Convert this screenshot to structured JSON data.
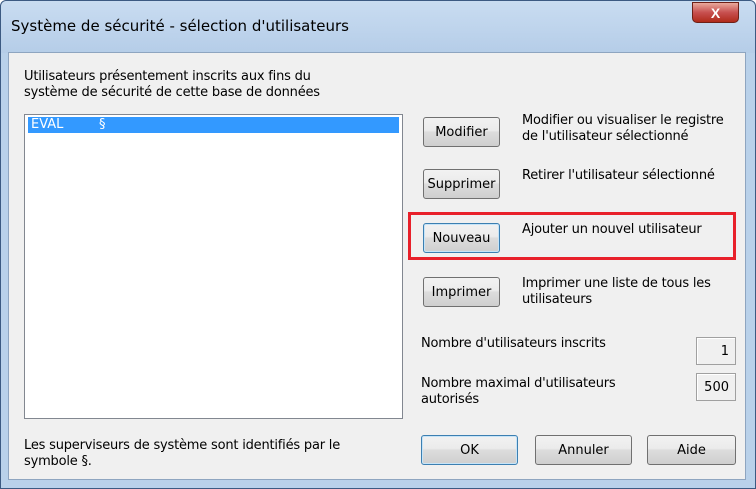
{
  "window": {
    "title": "Système de sécurité - sélection d'utilisateurs",
    "close_glyph": "X"
  },
  "intro_text": [
    "Utilisateurs présentement inscrits aux fins du",
    "système de sécurité de cette base de données"
  ],
  "users": [
    {
      "name": "EVAL",
      "marker": "§",
      "selected": true
    }
  ],
  "actions": {
    "modify": {
      "label": "Modifier",
      "description": [
        "Modifier ou visualiser le registre",
        "de l'utilisateur sélectionné"
      ]
    },
    "delete": {
      "label": "Supprimer",
      "description": [
        "Retirer l'utilisateur sélectionné"
      ]
    },
    "new": {
      "label": "Nouveau",
      "description": [
        "Ajouter un nouvel utilisateur"
      ]
    },
    "print": {
      "label": "Imprimer",
      "description": [
        "Imprimer une liste de tous les",
        "utilisateurs"
      ]
    }
  },
  "stats": {
    "registered_label": "Nombre d'utilisateurs inscrits",
    "registered_value": "1",
    "max_label": [
      "Nombre maximal d'utilisateurs",
      "autorisés"
    ],
    "max_value": "500"
  },
  "footer_text": [
    "Les superviseurs de système sont identifiés par le",
    "symbole §."
  ],
  "buttons": {
    "ok": "OK",
    "cancel": "Annuler",
    "help": "Aide"
  },
  "colors": {
    "selection": "#3399ff",
    "highlight": "#e8202a",
    "titlebar": "#b9d1ea"
  }
}
